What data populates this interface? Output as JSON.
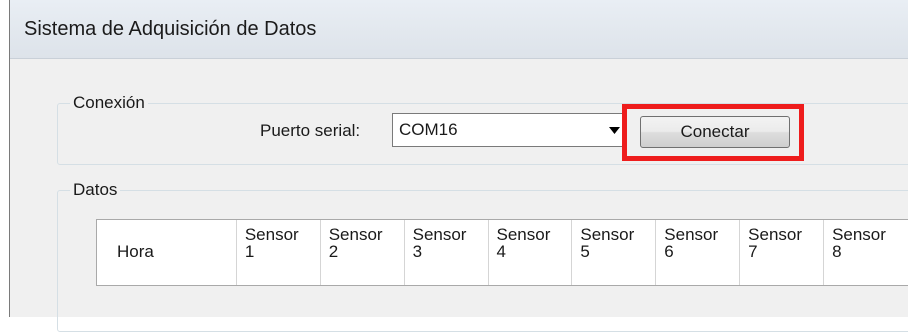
{
  "window": {
    "title": "Sistema de Adquisición de Datos"
  },
  "conexion": {
    "legend": "Conexión",
    "port_label": "Puerto serial:",
    "port_value": "COM16",
    "connect_button": "Conectar",
    "highlight_color": "#ee1c1c"
  },
  "datos": {
    "legend": "Datos",
    "columns": [
      "Hora",
      "Sensor\n1",
      "Sensor\n2",
      "Sensor\n3",
      "Sensor\n4",
      "Sensor\n5",
      "Sensor\n6",
      "Sensor\n7",
      "Sensor\n8"
    ]
  }
}
